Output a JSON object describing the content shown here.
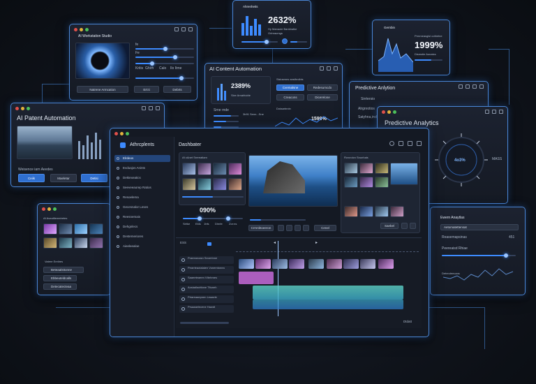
{
  "windows": {
    "top_left": {
      "title": "AI Workstation Studio",
      "slider_labels": [
        "fe",
        "Fe"
      ],
      "row_labels": [
        "Kritis",
        "Ghirh",
        "Calo",
        "Ilo Itme"
      ],
      "buttons": [
        "Natrene Armcation",
        "Ert:ti",
        "Debrts"
      ]
    },
    "top_center": {
      "title": "Ahrenheits",
      "value": "2632%",
      "caption1": "Hy Manaoie Bankbatke",
      "caption2": "Grlnraumgs"
    },
    "top_right": {
      "title": "Gernbin",
      "value": "1999%",
      "caption1": "Prmmeasgisl cotbetne",
      "caption2": "Dismstie Aunatcs"
    },
    "content_automation": {
      "title": "AI Content Automation",
      "value": "2389%",
      "caption": "Sixe Arnahtoirle",
      "side_title": "Sisiusmns ansthrcibis",
      "buttons": [
        "Cvemalsne",
        "Redesumcdo",
        "Creacons",
        "Dicerelone"
      ],
      "value2": "1599%",
      "left_small": "Srne rnde",
      "legend": "3b91 Senn...Sne",
      "stat_line": "Dotaartnnin"
    },
    "predictive_bg": {
      "title": "Predictive Anlytion",
      "rows": [
        "Sirrtersio",
        "Alrgnrotios",
        "Satyhna,inch"
      ]
    },
    "patent": {
      "title": "AI Patent Automation",
      "caption": "Weisence iarn Aeedes",
      "buttons": [
        "Ceiik",
        "Maeletar",
        "Detisi"
      ]
    },
    "predictive": {
      "title": "Predictive Analytics",
      "gauge": "4o3%",
      "right_label": "MASS"
    },
    "gallery": {
      "title": "Af Avealtlenreiretes",
      "list_title": "Vatere Ereiires",
      "items": [
        "Beteaalsttonne",
        "Ebbeuteldcalls",
        "Detecatecteaa"
      ]
    },
    "event": {
      "title": "Ewern Anaytlas",
      "dropdown": "Aetomatettensat",
      "row": "Reasemapsinas",
      "row_val": "451",
      "slider_label": "Peereaisd Rhiae",
      "chart_label": "Detrecteecans"
    },
    "main": {
      "app_title": "Athrcplents",
      "window_title": "Dashbater",
      "sidebar": [
        "Elrdeos",
        "Evduajos Anints",
        "Dektexeatics",
        "Seeveeaorep Ratios",
        "Resoelema",
        "Gecesnalor Leses",
        "Reesnemais",
        "Dehgnlecs",
        "Destemeriores",
        "Aieeleealoe"
      ],
      "media_title": "Af cAnet Srereatiam",
      "preview_value": "090%",
      "preview_stats": [
        "Sirtke",
        "Ebls",
        "1hfs",
        "Dlrnfe",
        "Zor:ns"
      ],
      "preview_btn": "Crmnbtoeeron",
      "action_btn": "Cenel",
      "right_panel_title": "Rcrcroicn Snunhais",
      "right_panel_btn": "Saebel",
      "timeline_label": "ESS",
      "tracks": [
        "Praeearcasn Seoertnne",
        "Pearrleaotalaien Vonemtonea",
        "Saaeeteaeen Vtbrhmes",
        "Aosiadlacttione Tltuneh",
        "Prtareaaepnen Leaaele",
        "Prsaaaelecene Hawdt"
      ],
      "status": "Dtdatt"
    }
  },
  "colors": {
    "accent": "#3d8bff",
    "window_border": "#4a86d6",
    "clip_pink": "#c66ad8",
    "clip_cyan": "#5fd6c8"
  }
}
